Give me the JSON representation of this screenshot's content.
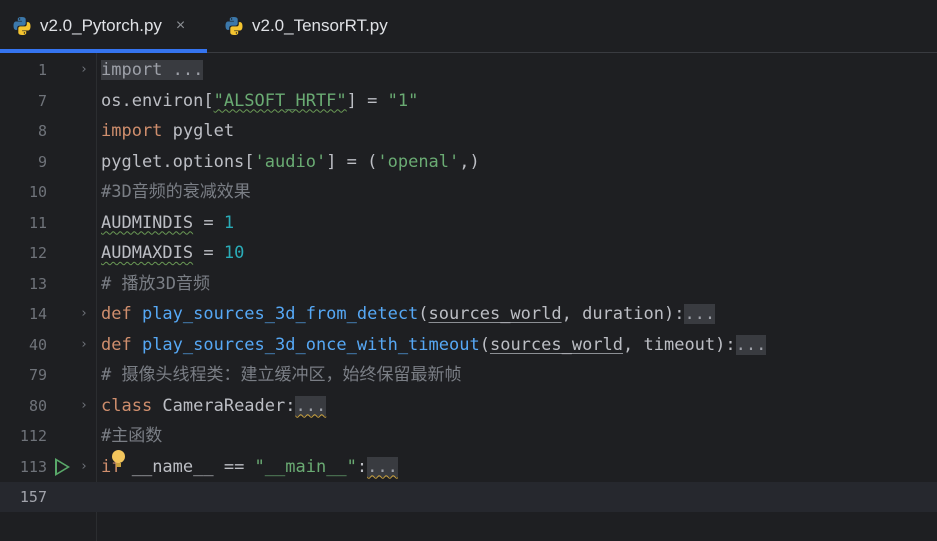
{
  "tabs": [
    {
      "label": "v2.0_Pytorch.py",
      "active": true,
      "close": "×"
    },
    {
      "label": "v2.0_TensorRT.py",
      "active": false
    }
  ],
  "lines": [
    {
      "num": "1",
      "fold": "›",
      "tokens": [
        {
          "t": "import ...",
          "c": "fold-text"
        }
      ]
    },
    {
      "num": "7",
      "tokens": [
        {
          "t": "os.environ[",
          "c": "txt"
        },
        {
          "t": "\"ALSOFT_HRTF\"",
          "c": "str wave"
        },
        {
          "t": "] = ",
          "c": "txt"
        },
        {
          "t": "\"1\"",
          "c": "str"
        }
      ]
    },
    {
      "num": "8",
      "tokens": [
        {
          "t": "import ",
          "c": "kw"
        },
        {
          "t": "pyglet",
          "c": "txt"
        }
      ]
    },
    {
      "num": "9",
      "tokens": [
        {
          "t": "pyglet.options[",
          "c": "txt"
        },
        {
          "t": "'audio'",
          "c": "str"
        },
        {
          "t": "] = (",
          "c": "txt"
        },
        {
          "t": "'openal'",
          "c": "str"
        },
        {
          "t": ",)",
          "c": "txt"
        }
      ]
    },
    {
      "num": "10",
      "tokens": [
        {
          "t": "#3D音频的衰减效果",
          "c": "cmt"
        }
      ]
    },
    {
      "num": "11",
      "tokens": [
        {
          "t": "AUDMINDIS",
          "c": "txt wave"
        },
        {
          "t": " = ",
          "c": "txt"
        },
        {
          "t": "1",
          "c": "num"
        }
      ]
    },
    {
      "num": "12",
      "tokens": [
        {
          "t": "AUDMAXDIS",
          "c": "txt wave"
        },
        {
          "t": " = ",
          "c": "txt"
        },
        {
          "t": "10",
          "c": "num"
        }
      ]
    },
    {
      "num": "13",
      "tokens": [
        {
          "t": "# 播放3D音频",
          "c": "cmt"
        }
      ]
    },
    {
      "num": "14",
      "fold": "›",
      "tokens": [
        {
          "t": "def ",
          "c": "kw"
        },
        {
          "t": "play_sources_3d_from_detect",
          "c": "fn"
        },
        {
          "t": "(",
          "c": "txt"
        },
        {
          "t": "sources_world",
          "c": "txt name-mark"
        },
        {
          "t": ", duration):",
          "c": "txt"
        },
        {
          "t": "...",
          "c": "dots"
        }
      ]
    },
    {
      "num": "40",
      "fold": "›",
      "tokens": [
        {
          "t": "def ",
          "c": "kw"
        },
        {
          "t": "play_sources_3d_once_with_timeout",
          "c": "fn"
        },
        {
          "t": "(",
          "c": "txt"
        },
        {
          "t": "sources_world",
          "c": "txt name-mark"
        },
        {
          "t": ", timeout):",
          "c": "txt"
        },
        {
          "t": "...",
          "c": "dots"
        }
      ]
    },
    {
      "num": "79",
      "tokens": [
        {
          "t": "# 摄像头线程类：建立缓冲区，始终保留最新帧",
          "c": "cmt"
        }
      ]
    },
    {
      "num": "80",
      "fold": "›",
      "tokens": [
        {
          "t": "class ",
          "c": "kw"
        },
        {
          "t": "CameraReader:",
          "c": "txt"
        },
        {
          "t": "...",
          "c": "dots wave-y"
        }
      ]
    },
    {
      "num": "112",
      "tokens": [
        {
          "t": "#主函数",
          "c": "cmt"
        }
      ]
    },
    {
      "num": "113",
      "fold": "›",
      "run": true,
      "bulb": true,
      "tokens": [
        {
          "t": "if",
          "c": "kw"
        },
        {
          "t": " __name__ == ",
          "c": "txt"
        },
        {
          "t": "\"__main__\"",
          "c": "str"
        },
        {
          "t": ":",
          "c": "txt"
        },
        {
          "t": "...",
          "c": "dots wave-y"
        }
      ]
    },
    {
      "num": "157",
      "current": true,
      "tokens": []
    }
  ],
  "colors": {
    "accent": "#3574f0",
    "keyword": "#cf8e6d",
    "function": "#56a8f5",
    "string": "#6aab73",
    "number": "#2aacb8",
    "comment": "#7a7e85"
  }
}
